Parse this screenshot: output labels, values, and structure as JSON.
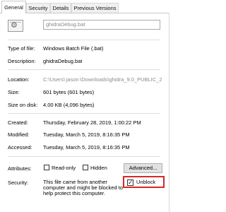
{
  "tabs": [
    "General",
    "Security",
    "Details",
    "Previous Versions"
  ],
  "file_name": "ghidraDebug.bat",
  "icons": {
    "file": "batch-file-gear-icon",
    "check": "checkmark-icon"
  },
  "rows": {
    "type": {
      "label": "Type of file:",
      "value": "Windows Batch File (.bat)"
    },
    "description": {
      "label": "Description:",
      "value": "ghidraDebug.bat"
    },
    "location": {
      "label": "Location:",
      "value": "C:\\Users\\ jason \\Downloads\\ghidra_9.0_PUBLIC_2"
    },
    "size": {
      "label": "Size:",
      "value": "601 bytes (601 bytes)"
    },
    "size_on_disk": {
      "label": "Size on disk:",
      "value": "4.00 KB (4,096 bytes)"
    },
    "created": {
      "label": "Created:",
      "value": "Thursday, February 28, 2019, 1:00:22 PM"
    },
    "modified": {
      "label": "Modified:",
      "value": "Tuesday, March 5, 2019, 8:16:35 PM"
    },
    "accessed": {
      "label": "Accessed:",
      "value": "Tuesday, March 5, 2019, 8:16:35 PM"
    }
  },
  "attributes": {
    "label": "Attributes:",
    "read_only": "Read-only",
    "hidden": "Hidden",
    "advanced": "Advanced..."
  },
  "security": {
    "label": "Security:",
    "text": "This file came from another computer and might be blocked to help protect this computer.",
    "unblock": "Unblock",
    "unblock_checked": true,
    "highlight_color": "#d62828"
  }
}
